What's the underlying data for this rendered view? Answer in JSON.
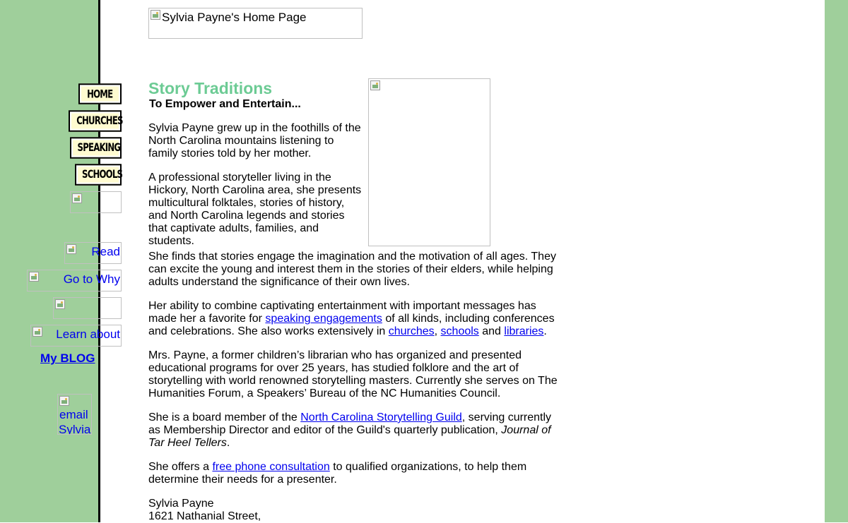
{
  "header": {
    "banner_alt": "Sylvia Payne's Home Page"
  },
  "nav": {
    "home": "HOME",
    "churches": "CHURCHES",
    "speaking": "SPEAKING",
    "schools": "SCHOOLS",
    "read_alt": "Read",
    "why_alt": "Go to Why",
    "learn_alt": "Learn about",
    "blog": "My BLOG",
    "email_alt_1": "email",
    "email_alt_2": "Sylvia!"
  },
  "main": {
    "title": "Story Traditions",
    "subtitle": "To Empower and Entertain...",
    "p1": "Sylvia Payne grew up in the foothills of the North Carolina mountains listening to family stories told by her mother.",
    "p2": "A professional storyteller living in the Hickory, North Carolina area, she presents multicultural folktales, stories of history, and North Carolina legends and stories that captivate adults, families, and students.",
    "p3": "She finds that stories engage the imagination and the motivation of all ages. They can excite the young and interest them in the stories of their elders, while helping adults understand the significance of their own lives.",
    "p4_a": "Her ability to combine captivating entertainment with important messages has made her a favorite for ",
    "p4_link_speaking": "speaking engagements",
    "p4_b": " of all kinds, including conferences and celebrations. She also works extensively in ",
    "p4_link_churches": "churches",
    "p4_c": ", ",
    "p4_link_schools": "schools",
    "p4_d": " and ",
    "p4_link_libraries": "libraries",
    "p4_e": ".",
    "p5": "Mrs. Payne, a former children’s librarian who has organized and presented educational programs for over 25 years, has studied folklore and the art of storytelling with world renowned storytelling masters. Currently she serves on The Humanities Forum, a Speakers’ Bureau of the NC Humanities Council.",
    "p6_a": "She is a board member of the ",
    "p6_link_guild": "North Carolina Storytelling Guild",
    "p6_b": ", serving currently as Membership Director and editor of the Guild's quarterly publication, ",
    "p6_pub": "Journal of Tar Heel Tellers",
    "p6_c": ".",
    "p7_a": "She offers a ",
    "p7_link_consult": "free phone consultation",
    "p7_b": " to qualified organizations, to help them determine their needs for a presenter.",
    "addr_name": "Sylvia Payne",
    "addr_street": "1621 Nathanial Street,"
  }
}
